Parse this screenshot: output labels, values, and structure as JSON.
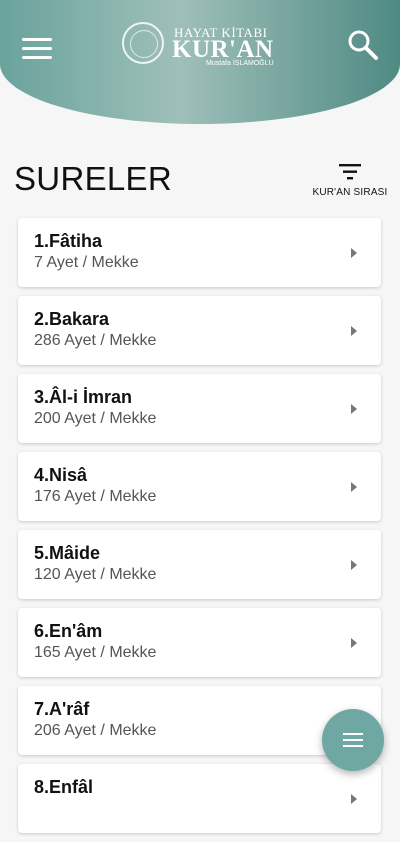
{
  "header": {
    "logo_top": "HAYAT KİTABI",
    "logo_main": "KUR'AN",
    "logo_author": "Mustafa İSLAMOĞLU"
  },
  "page_title": "SURELER",
  "sort_label": "KUR'AN SIRASI",
  "colors": {
    "header": "#6aa39c",
    "fab": "#6fa8a2"
  },
  "icons": [
    "menu-icon",
    "search-icon",
    "filter-icon",
    "chevron-right-icon",
    "menu-icon"
  ],
  "surahs": [
    {
      "title": "1.Fâtiha",
      "sub": "7 Ayet / Mekke"
    },
    {
      "title": "2.Bakara",
      "sub": "286 Ayet / Mekke"
    },
    {
      "title": "3.Âl-i İmran",
      "sub": "200 Ayet / Mekke"
    },
    {
      "title": "4.Nisâ",
      "sub": "176 Ayet / Mekke"
    },
    {
      "title": "5.Mâide",
      "sub": "120 Ayet / Mekke"
    },
    {
      "title": "6.En'âm",
      "sub": "165 Ayet / Mekke"
    },
    {
      "title": "7.A'râf",
      "sub": "206 Ayet / Mekke"
    },
    {
      "title": "8.Enfâl",
      "sub": ""
    }
  ]
}
